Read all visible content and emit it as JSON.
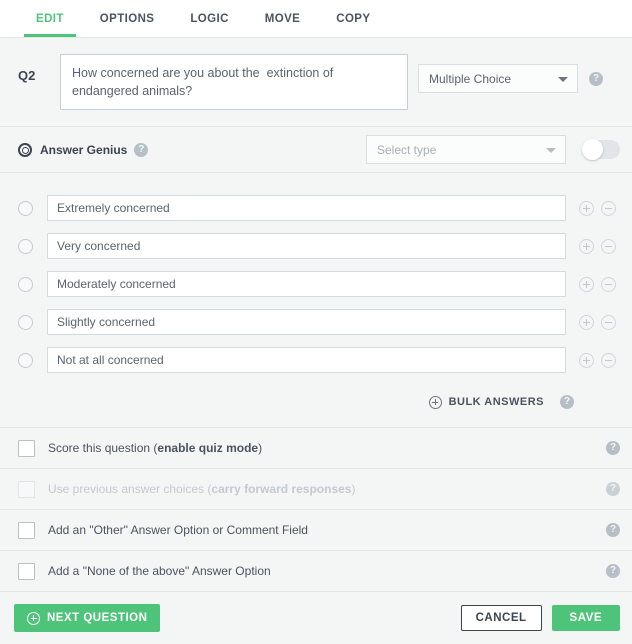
{
  "tabs": [
    {
      "label": "EDIT",
      "active": true
    },
    {
      "label": "OPTIONS",
      "active": false
    },
    {
      "label": "LOGIC",
      "active": false
    },
    {
      "label": "MOVE",
      "active": false
    },
    {
      "label": "COPY",
      "active": false
    }
  ],
  "question": {
    "number_label": "Q2",
    "text": "How concerned are you about the  extinction of endangered animals?",
    "type_value": "Multiple Choice",
    "help_icon": "help-icon"
  },
  "answer_genius": {
    "label": "Answer Genius",
    "icon": "target-icon",
    "select_placeholder": "Select type",
    "toggle_state": "off",
    "help_icon": "help-icon"
  },
  "answers": [
    {
      "value": "Extremely concerned"
    },
    {
      "value": "Very concerned"
    },
    {
      "value": "Moderately concerned"
    },
    {
      "value": "Slightly concerned"
    },
    {
      "value": "Not at all concerned"
    }
  ],
  "row_controls": {
    "add_icon": "plus-circle-icon",
    "remove_icon": "minus-circle-icon"
  },
  "bulk": {
    "label": "BULK ANSWERS",
    "icon": "plus-circle-icon",
    "help_icon": "help-icon"
  },
  "options": [
    {
      "text_plain": "Score this question (",
      "text_bold": "enable quiz mode",
      "text_tail": ")",
      "checked": false,
      "disabled": false
    },
    {
      "text_plain": "Use previous answer choices (",
      "text_bold": "carry forward responses",
      "text_tail": ")",
      "checked": false,
      "disabled": true
    },
    {
      "text_plain": "Add an \"Other\" Answer Option or Comment Field",
      "text_bold": "",
      "text_tail": "",
      "checked": false,
      "disabled": false
    },
    {
      "text_plain": "Add a \"None of the above\" Answer Option",
      "text_bold": "",
      "text_tail": "",
      "checked": false,
      "disabled": false
    }
  ],
  "footer": {
    "next_label": "NEXT QUESTION",
    "next_icon": "plus-circle-icon",
    "cancel_label": "CANCEL",
    "save_label": "SAVE"
  },
  "colors": {
    "accent_green": "#4ec47b",
    "page_bg": "#f4f6f6",
    "text": "#4a5360",
    "border": "#e3e6e8"
  }
}
